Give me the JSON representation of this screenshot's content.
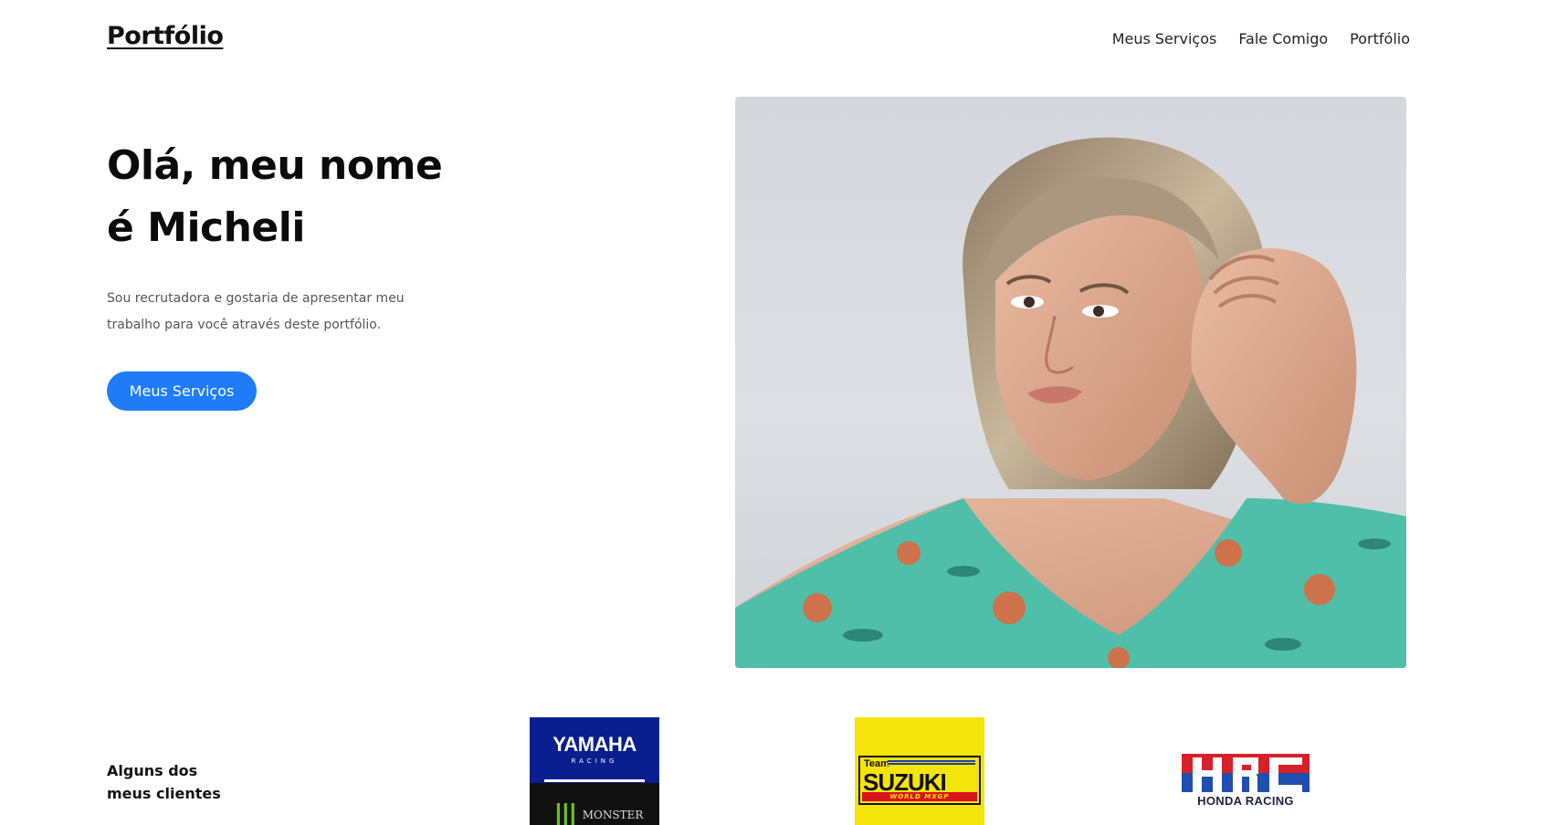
{
  "header": {
    "logo": "Portfólio",
    "nav": [
      "Meus Serviços",
      "Fale Comigo",
      "Portfólio"
    ]
  },
  "hero": {
    "title_line1": "Olá, meu nome",
    "title_line2": "é Micheli",
    "description": "Sou recrutadora e gostaria de apresentar meu trabalho para você através deste portfólio.",
    "button_label": "Meus Serviços",
    "button_color": "#1f7bf6"
  },
  "clients": {
    "label": "Alguns dos meus clientes",
    "logos": [
      {
        "name": "yamaha-monster-logo",
        "text_main": "YAMAHA",
        "text_sub": "RACING",
        "text_sponsor": "MONSTER"
      },
      {
        "name": "suzuki-logo",
        "text_team": "Team",
        "text_main": "SUZUKI",
        "text_sub": "WORLD MXGP"
      },
      {
        "name": "hrc-logo",
        "text_main": "HRC",
        "text_sub": "HONDA RACING"
      }
    ]
  }
}
